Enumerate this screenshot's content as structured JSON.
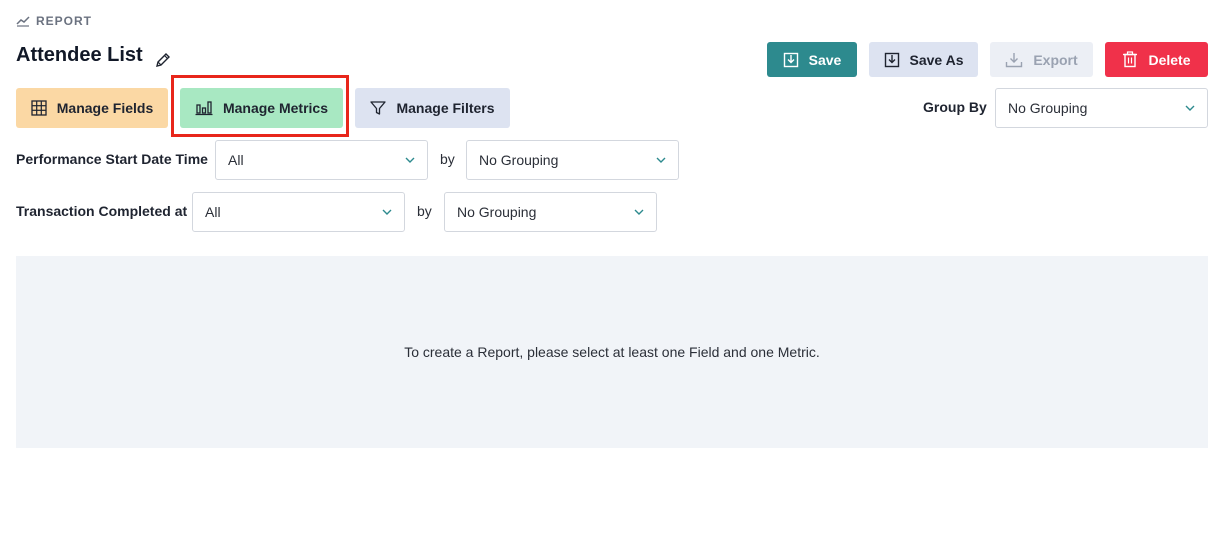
{
  "breadcrumb": {
    "label": "REPORT",
    "icon": "trend-line-icon"
  },
  "report": {
    "title": "Attendee List"
  },
  "header_actions": {
    "save": "Save",
    "save_as": "Save As",
    "export": "Export",
    "delete": "Delete"
  },
  "toolbar": {
    "manage_fields": "Manage Fields",
    "manage_metrics": "Manage Metrics",
    "manage_filters": "Manage Filters"
  },
  "group_by": {
    "label": "Group By",
    "value": "No Grouping"
  },
  "filters": [
    {
      "label": "Performance Start Date Time",
      "value": "All",
      "by_label": "by",
      "grouping": "No Grouping"
    },
    {
      "label": "Transaction Completed at",
      "value": "All",
      "by_label": "by",
      "grouping": "No Grouping"
    }
  ],
  "empty_state": {
    "message": "To create a Report, please select at least one Field and one Metric."
  },
  "colors": {
    "save": "#2d8a8e",
    "delete": "#f0314a",
    "manage_fields": "#fbd8a4",
    "manage_metrics": "#a8e8c2",
    "manage_filters": "#dde3f1",
    "highlight": "#e8261b"
  }
}
